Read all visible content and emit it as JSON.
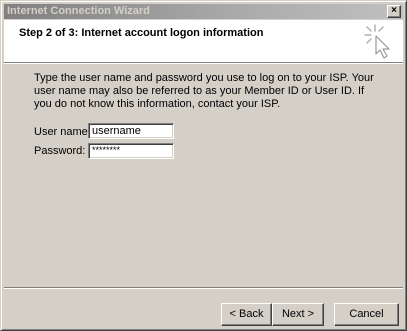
{
  "window": {
    "title": "Internet Connection Wizard",
    "close_glyph": "×"
  },
  "header": {
    "title": "Step 2 of 3: Internet account logon information",
    "icon": "wizard-sparkle-cursor-icon"
  },
  "main": {
    "description": "Type the user name and password you use to log on to your ISP. Your user name may also be referred to as your Member ID or User ID. If you do not know this information, contact your ISP.",
    "username_label": "User name:",
    "username_value": "username",
    "password_label": "Password:",
    "password_value": "********"
  },
  "footer": {
    "back_label": "< Back",
    "next_label": "Next >",
    "cancel_label": "Cancel"
  }
}
